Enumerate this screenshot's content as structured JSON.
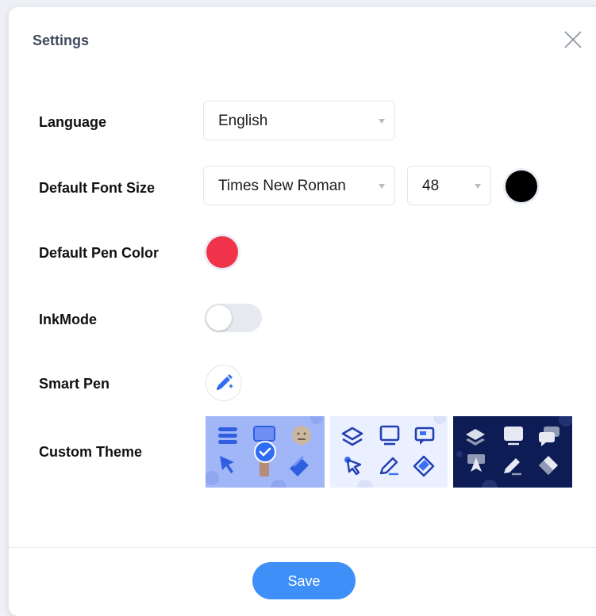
{
  "dialog": {
    "title": "Settings"
  },
  "language": {
    "label": "Language",
    "value": "English"
  },
  "font_size": {
    "label": "Default Font Size",
    "font_value": "Times New Roman",
    "size_value": "48",
    "color": "#000000"
  },
  "pen_color": {
    "label": "Default Pen Color",
    "color": "#f0334a"
  },
  "ink_mode": {
    "label": "InkMode",
    "enabled": false
  },
  "smart_pen": {
    "label": "Smart Pen",
    "icon": "pen-sparkle-icon"
  },
  "custom_theme": {
    "label": "Custom Theme",
    "themes": [
      {
        "name": "blue",
        "background": "#a1b6f7",
        "selected": true
      },
      {
        "name": "light",
        "background": "#eaf0ff",
        "selected": false
      },
      {
        "name": "navy",
        "background": "#0e1c55",
        "selected": false
      }
    ]
  },
  "footer": {
    "save_label": "Save"
  },
  "colors": {
    "accent": "#3e8ff7",
    "title": "#3f4a5c"
  }
}
